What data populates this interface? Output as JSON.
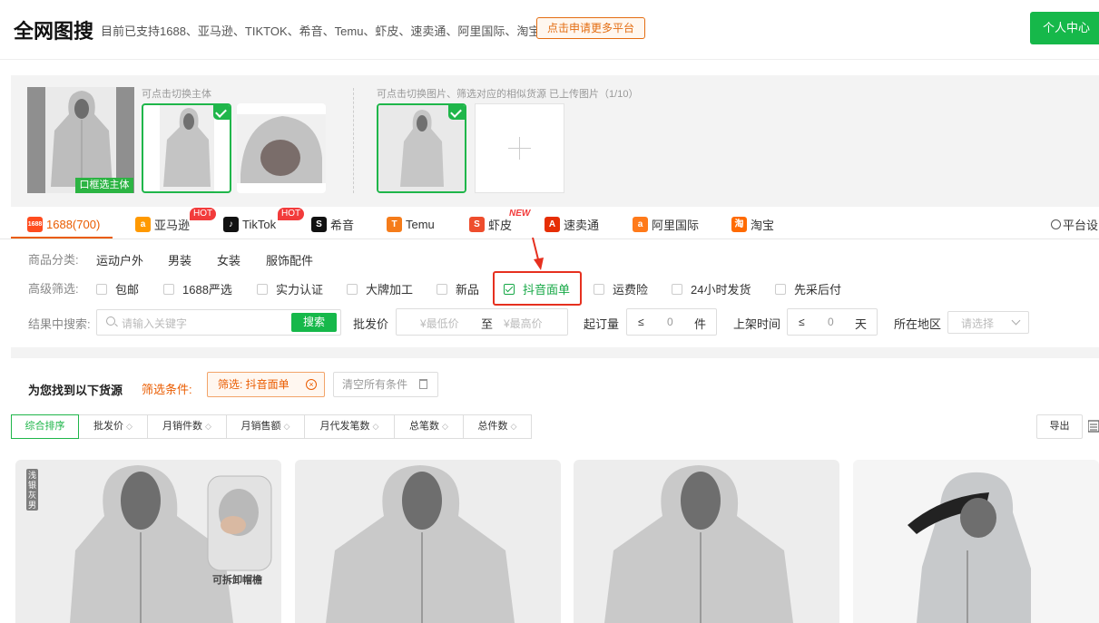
{
  "header": {
    "title": "全网图搜",
    "subtitle": "目前已支持1688、亚马逊、TIKTOK、希音、Temu、虾皮、速卖通、阿里国际、淘宝",
    "apply_button": "点击申请更多平台",
    "personal_button": "个人中心"
  },
  "image_panel": {
    "subject_hint": "可点击切换主体",
    "frame_tag": "口框选主体",
    "image_hint": "可点击切换图片、筛选对应的相似货源 已上传图片（1/10）"
  },
  "platforms": [
    {
      "label": "1688(700)",
      "active": true,
      "color": "#ff4c1f",
      "icon": "1688-logo-icon",
      "logo": "1688"
    },
    {
      "label": "亚马逊",
      "badge": "HOT",
      "color": "#ff9900",
      "icon": "amazon-logo-icon",
      "logo": "a"
    },
    {
      "label": "TikTok",
      "badge": "HOT",
      "color": "#111111",
      "icon": "tiktok-logo-icon",
      "logo": "♪"
    },
    {
      "label": "希音",
      "color": "#111111",
      "icon": "shein-logo-icon",
      "logo": "S"
    },
    {
      "label": "Temu",
      "color": "#f57c1a",
      "icon": "temu-logo-icon",
      "logo": "T"
    },
    {
      "label": "虾皮",
      "badge": "NEW",
      "color": "#ee4d2d",
      "icon": "shopee-logo-icon",
      "logo": "S"
    },
    {
      "label": "速卖通",
      "color": "#e62e04",
      "icon": "aliexpress-logo-icon",
      "logo": "A"
    },
    {
      "label": "阿里国际",
      "color": "#ff7a1a",
      "icon": "alibaba-logo-icon",
      "logo": "a"
    },
    {
      "label": "淘宝",
      "color": "#ff6a00",
      "icon": "taobao-logo-icon",
      "logo": "淘"
    }
  ],
  "platform_settings": "平台设",
  "filters": {
    "category_label": "商品分类:",
    "categories": [
      "运动户外",
      "男装",
      "女装",
      "服饰配件"
    ],
    "advanced_label": "高级筛选:",
    "advanced": [
      {
        "label": "包邮",
        "checked": false
      },
      {
        "label": "1688严选",
        "checked": false
      },
      {
        "label": "实力认证",
        "checked": false
      },
      {
        "label": "大牌加工",
        "checked": false
      },
      {
        "label": "新品",
        "checked": false
      },
      {
        "label": "抖音面单",
        "checked": true
      },
      {
        "label": "运费险",
        "checked": false
      },
      {
        "label": "24小时发货",
        "checked": false
      },
      {
        "label": "先采后付",
        "checked": false
      }
    ],
    "search_label": "结果中搜索:",
    "search_placeholder": "请输入关键字",
    "search_button": "搜索",
    "price_label": "批发价",
    "price_min_placeholder": "¥最低价",
    "price_to": "至",
    "price_max_placeholder": "¥最高价",
    "moq_label": "起订量",
    "moq_op": "≤",
    "moq_value": "0",
    "moq_unit": "件",
    "listed_label": "上架时间",
    "listed_op": "≤",
    "listed_value": "0",
    "listed_unit": "天",
    "region_label": "所在地区",
    "region_placeholder": "请选择"
  },
  "results": {
    "found_text": "为您找到以下货源",
    "condition_label": "筛选条件:",
    "condition_chip": "筛选:  抖音面单",
    "clear_all": "清空所有条件"
  },
  "sort_tabs": [
    {
      "label": "综合排序",
      "active": true
    },
    {
      "label": "批发价"
    },
    {
      "label": "月销件数"
    },
    {
      "label": "月销售额"
    },
    {
      "label": "月代发笔数"
    },
    {
      "label": "总笔数"
    },
    {
      "label": "总件数"
    }
  ],
  "export_button": "导出",
  "cards": [
    {
      "side_badge": "浅银灰男",
      "detach_label": "可拆卸帽檐"
    },
    {},
    {},
    {}
  ]
}
